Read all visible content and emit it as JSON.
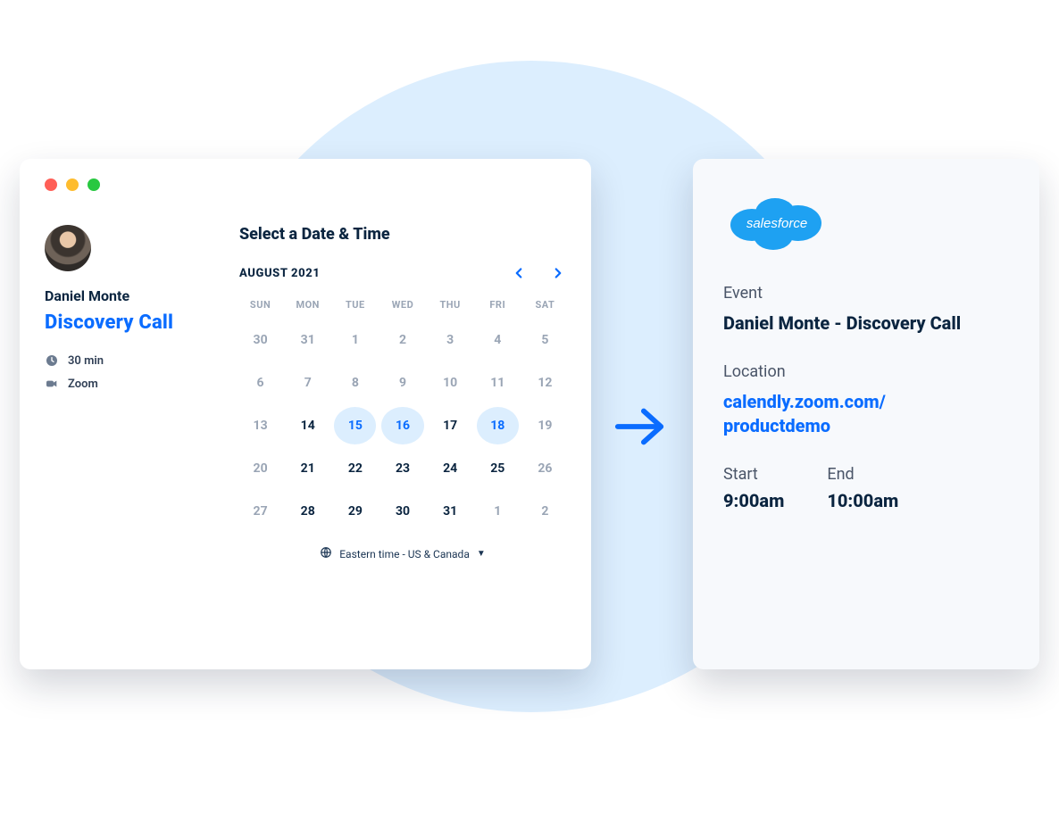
{
  "calendly": {
    "host_name": "Daniel Monte",
    "event_title": "Discovery Call",
    "duration": "30 min",
    "location": "Zoom",
    "select_heading": "Select a Date & Time",
    "month_label": "AUGUST 2021",
    "dow": [
      "SUN",
      "MON",
      "TUE",
      "WED",
      "THU",
      "FRI",
      "SAT"
    ],
    "days": [
      {
        "n": "30",
        "active": false
      },
      {
        "n": "31",
        "active": false
      },
      {
        "n": "1",
        "active": false
      },
      {
        "n": "2",
        "active": false
      },
      {
        "n": "3",
        "active": false
      },
      {
        "n": "4",
        "active": false
      },
      {
        "n": "5",
        "active": false
      },
      {
        "n": "6",
        "active": false
      },
      {
        "n": "7",
        "active": false
      },
      {
        "n": "8",
        "active": false
      },
      {
        "n": "9",
        "active": false
      },
      {
        "n": "10",
        "active": false
      },
      {
        "n": "11",
        "active": false
      },
      {
        "n": "12",
        "active": false
      },
      {
        "n": "13",
        "active": false
      },
      {
        "n": "14",
        "active": true
      },
      {
        "n": "15",
        "active": true,
        "selected": true
      },
      {
        "n": "16",
        "active": true,
        "selected": true
      },
      {
        "n": "17",
        "active": true
      },
      {
        "n": "18",
        "active": true,
        "selected": true
      },
      {
        "n": "19",
        "active": false
      },
      {
        "n": "20",
        "active": false
      },
      {
        "n": "21",
        "active": true
      },
      {
        "n": "22",
        "active": true
      },
      {
        "n": "23",
        "active": true
      },
      {
        "n": "24",
        "active": true
      },
      {
        "n": "25",
        "active": true
      },
      {
        "n": "26",
        "active": false
      },
      {
        "n": "27",
        "active": false
      },
      {
        "n": "28",
        "active": true
      },
      {
        "n": "29",
        "active": true
      },
      {
        "n": "30",
        "active": true
      },
      {
        "n": "31",
        "active": true
      },
      {
        "n": "1",
        "active": false
      },
      {
        "n": "2",
        "active": false
      }
    ],
    "timezone": "Eastern time - US & Canada"
  },
  "salesforce": {
    "logo_text": "salesforce",
    "event_label": "Event",
    "event_value": "Daniel Monte - Discovery Call",
    "location_label": "Location",
    "location_value": "calendly.zoom.com/\nproductdemo",
    "start_label": "Start",
    "start_value": "9:00am",
    "end_label": "End",
    "end_value": "10:00am"
  }
}
